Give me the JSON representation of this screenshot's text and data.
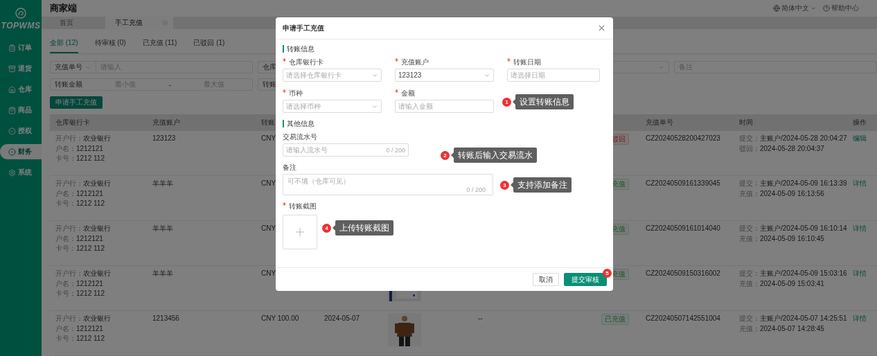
{
  "sidebar": {
    "logo": "TOPWMS",
    "items": [
      {
        "label": "订单",
        "selected": false
      },
      {
        "label": "退货",
        "selected": false
      },
      {
        "label": "仓库",
        "selected": false
      },
      {
        "label": "商品",
        "selected": false
      },
      {
        "label": "授权",
        "selected": false
      },
      {
        "label": "财务",
        "selected": true
      },
      {
        "label": "系统",
        "selected": false
      }
    ]
  },
  "header": {
    "title": "商家端",
    "language": "简体中文",
    "help": "帮助中心"
  },
  "page_tabs": [
    {
      "label": "首页",
      "selected": false,
      "closable": false
    },
    {
      "label": "手工充值",
      "selected": true,
      "closable": true
    }
  ],
  "status_tabs": [
    {
      "label": "全部 (12)",
      "selected": true
    },
    {
      "label": "待审核 (0)",
      "selected": false
    },
    {
      "label": "已充值 (11)",
      "selected": false
    },
    {
      "label": "已驳回 (1)",
      "selected": false
    }
  ],
  "filters": [
    {
      "kind": "select-input",
      "select": "充值单号",
      "placeholder": "请输入"
    },
    {
      "kind": "cut",
      "label": "仓库"
    },
    {
      "kind": "select"
    },
    {
      "kind": "input",
      "placeholder": "备注"
    },
    {
      "kind": "range",
      "label": "转账金额",
      "min": "最小值",
      "separator": "-",
      "max": "最大值"
    },
    {
      "kind": "cut",
      "label": "转账"
    }
  ],
  "action_button": "申请手工充值",
  "table": {
    "columns": [
      "仓库银行卡",
      "充值账户",
      "转账"
    ],
    "columns_right": [
      "充值单号",
      "时间",
      "操作"
    ],
    "rows": [
      {
        "bank_card": [
          {
            "label": "开户行：",
            "value": "农业银行"
          },
          {
            "label": "户名：",
            "value": "1212121"
          },
          {
            "label": "卡号：",
            "value": "1212 112"
          }
        ],
        "account": "123123",
        "amount": "CNY",
        "status": {
          "text": "驳回",
          "kind": "rejected"
        },
        "order_no": "CZ20240528200427023",
        "times": [
          {
            "label": "提交：",
            "value": "主账户/2024-05-28 20:04:27"
          },
          {
            "label": "驳回：",
            "value": "2024-05-28 20:04:37"
          }
        ],
        "action": "编辑"
      },
      {
        "bank_card": [
          {
            "label": "开户行：",
            "value": "农业银行"
          },
          {
            "label": "户名：",
            "value": "1212121"
          },
          {
            "label": "卡号：",
            "value": "1212 112"
          }
        ],
        "account": "羊羊羊",
        "amount": "CNY",
        "status": {
          "text": "充值",
          "kind": "charged"
        },
        "order_no": "CZ20240509161339045",
        "times": [
          {
            "label": "提交：",
            "value": "主账户/2024-05-09 16:13:39"
          },
          {
            "label": "充值：",
            "value": "2024-05-09 16:13:56"
          }
        ],
        "action": "详情"
      },
      {
        "bank_card": [
          {
            "label": "开户行：",
            "value": "农业银行"
          },
          {
            "label": "户名：",
            "value": "1212121"
          },
          {
            "label": "卡号：",
            "value": "1212 112"
          }
        ],
        "account": "羊羊羊",
        "amount": "CNY",
        "status": {
          "text": "充值",
          "kind": "charged"
        },
        "order_no": "CZ20240509161014040",
        "times": [
          {
            "label": "提交：",
            "value": "主账户/2024-05-09 16:10:14"
          },
          {
            "label": "充值：",
            "value": "2024-05-09 16:10:45"
          }
        ],
        "action": "详情"
      },
      {
        "bank_card": [
          {
            "label": "开户行：",
            "value": "农业银行"
          },
          {
            "label": "户名：",
            "value": "1212121"
          },
          {
            "label": "卡号：",
            "value": "1212 112"
          }
        ],
        "account": "羊羊羊",
        "amount": "CNY",
        "image": {
          "kind": "picture"
        },
        "status": {
          "text": "充值",
          "kind": "charged"
        },
        "order_no": "CZ20240509150316002",
        "times": [
          {
            "label": "提交：",
            "value": "主账户/2024-05-09 15:03:16"
          },
          {
            "label": "充值：",
            "value": "2024-05-09 15:03:41"
          }
        ],
        "action": "详情"
      },
      {
        "bank_card": [
          {
            "label": "开户行：",
            "value": "农业银行"
          },
          {
            "label": "户名：",
            "value": "1212121"
          },
          {
            "label": "卡号：",
            "value": "1212 112"
          }
        ],
        "account": "1213456",
        "amount": "CNY 100.00",
        "date": "2024-05-07",
        "image": {
          "kind": "picture"
        },
        "remark": "--",
        "status": {
          "text": "已充值",
          "kind": "charged"
        },
        "order_no": "CZ20240507142551004",
        "times": [
          {
            "label": "提交：",
            "value": "主账户/2024-05-07 14:25:51"
          },
          {
            "label": "充值：",
            "value": "2024-05-07 14:28:45"
          }
        ],
        "action": "详情"
      }
    ]
  },
  "modal": {
    "title": "申请手工充值",
    "sections": [
      {
        "title": "转账信息",
        "fields": [
          {
            "label": "仓库银行卡",
            "required": true,
            "kind": "select",
            "placeholder": "请选择仓库银行卡"
          },
          {
            "label": "充值账户",
            "required": true,
            "kind": "select",
            "value": "123123"
          },
          {
            "label": "转账日期",
            "required": true,
            "kind": "input",
            "placeholder": "请选择日期"
          },
          {
            "label": "币种",
            "required": true,
            "kind": "select",
            "placeholder": "请选择币种"
          },
          {
            "label": "金额",
            "required": true,
            "kind": "input",
            "placeholder": "请输入金额"
          }
        ]
      },
      {
        "title": "其他信息",
        "fields": [
          {
            "label": "交易流水号",
            "required": false,
            "kind": "input",
            "placeholder": "请输入流水号",
            "counter": "0 / 200"
          },
          {
            "label": "备注",
            "required": false,
            "kind": "textarea",
            "placeholder": "可不填（仓库可见）",
            "counter": "0 / 200"
          },
          {
            "label": "转账截图",
            "required": true,
            "kind": "upload"
          }
        ]
      }
    ],
    "buttons": [
      {
        "label": "取消",
        "kind": "default"
      },
      {
        "label": "提交审核",
        "kind": "primary"
      }
    ],
    "callouts": [
      {
        "number": "1",
        "text": "设置转账信息"
      },
      {
        "number": "2",
        "text": "转账后输入交易流水"
      },
      {
        "number": "3",
        "text": "支持添加备注"
      },
      {
        "number": "4",
        "text": "上传转账截图"
      },
      {
        "number": "5"
      }
    ]
  }
}
